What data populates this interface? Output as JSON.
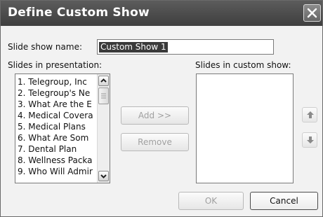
{
  "dialog": {
    "title": "Define Custom Show",
    "name_label": "Slide show name:",
    "name_value": "Custom Show 1",
    "slides_label": "Slides in presentation:",
    "custom_label": "Slides in custom show:",
    "slides": [
      "1. Telegroup, Inc",
      "2. Telegroup's Ne",
      "3. What Are the E",
      "4. Medical Covera",
      "5. Medical Plans",
      "6. What Are Som",
      "7. Dental Plan",
      "8. Wellness Packa",
      "9. Who Will Admir"
    ],
    "custom_slides": [],
    "add_label": "Add >>",
    "remove_label": "Remove",
    "ok_label": "OK",
    "cancel_label": "Cancel"
  },
  "icons": {
    "close": "close-icon",
    "move_up": "arrow-up-icon",
    "move_down": "arrow-down-icon",
    "scroll_up": "chevron-up-icon",
    "scroll_down": "chevron-down-icon"
  },
  "colors": {
    "titlebar": "#4a4a4a",
    "selection": "#3a3a3a",
    "dialog_bg": "#f2f2f2"
  }
}
